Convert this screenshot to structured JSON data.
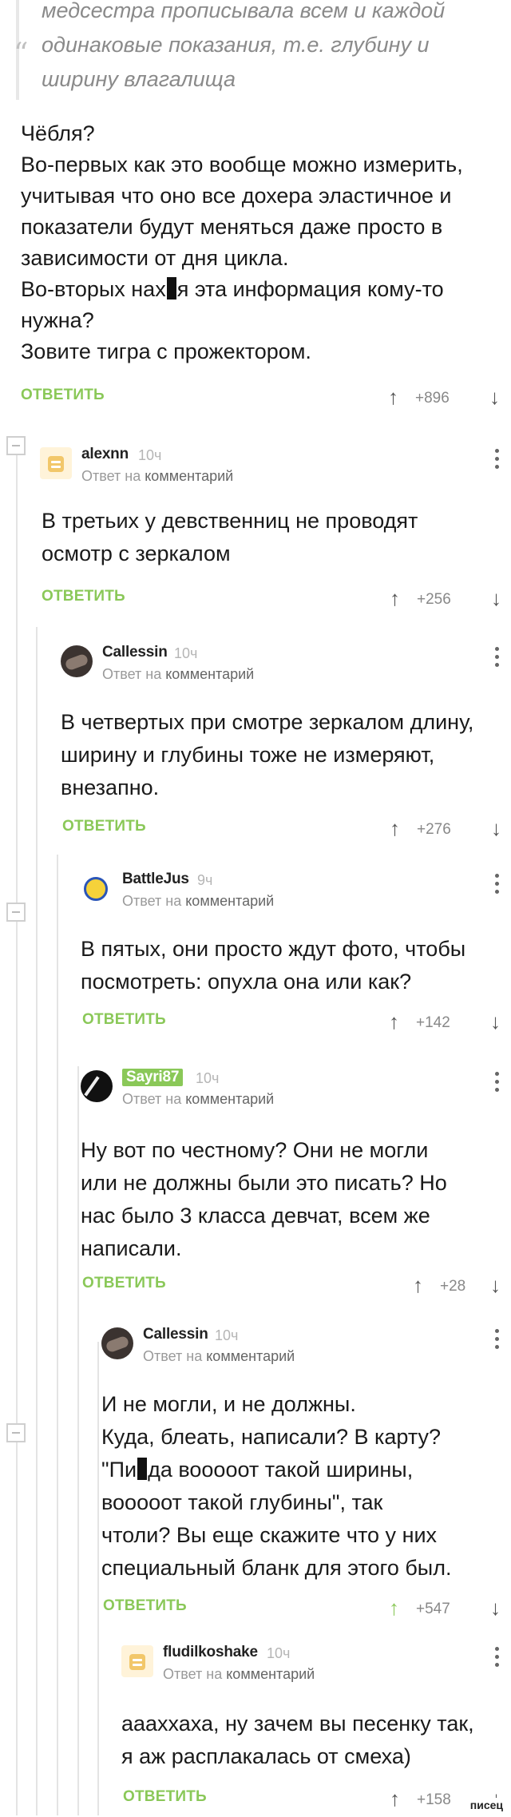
{
  "quote": {
    "lines": [
      "медсестра прописывала всем и каждой",
      "одинаковые показания, т.е. глубину и",
      "ширину влагалища"
    ]
  },
  "root": {
    "lines": [
      "Чёбля?",
      "Во-первых как это вообще можно измерить,",
      "учитывая что оно все дохера эластичное и",
      "показатели будут меняться даже просто в",
      "зависимости от дня цикла."
    ],
    "line6_a": "Во-вторых нах",
    "line6_b": "я эта информация кому-то",
    "line7": "нужна?",
    "line8": "Зовите тигра с прожектором.",
    "score": "+896"
  },
  "labels": {
    "reply": "ОТВЕТИТЬ",
    "reply_to": "Ответ на",
    "comment": "комментарий"
  },
  "comments": [
    {
      "user": "alexnn",
      "time": "10ч",
      "avatar": "egg-icon",
      "lines": [
        "В третьих у девственниц не проводят",
        "осмотр с зеркалом"
      ],
      "score": "+256"
    },
    {
      "user": "Callessin",
      "time": "10ч",
      "avatar": "photo-icon",
      "lines": [
        "В четвертых при смотре зеркалом длину,",
        "ширину и глубины тоже не измеряют,",
        "внезапно."
      ],
      "score": "+276"
    },
    {
      "user": "BattleJus",
      "time": "9ч",
      "avatar": "simpson-icon",
      "lines": [
        "В пятых, они просто ждут фото, чтобы",
        "посмотреть: опухла она или как?"
      ],
      "score": "+142"
    },
    {
      "user": "Sayri87",
      "time": "10ч",
      "avatar": "guitar-icon",
      "lines": [
        "Ну вот по честному? Они не могли",
        "или не должны были это писать? Но",
        "нас было 3 класса девчат, всем же",
        "написали."
      ],
      "score": "+28"
    },
    {
      "user": "Callessin",
      "time": "10ч",
      "avatar": "photo-icon",
      "lines": [
        "И не могли, и не должны.",
        "Куда, блеать, написали? В карту?"
      ],
      "line3_a": "\"Пи",
      "line3_b": "да вооооот такой ширины,",
      "lines_tail": [
        "вооооот такой глубины\", так",
        "чтоли? Вы еще скажите что у них",
        "специальный бланк для этого был."
      ],
      "score": "+547"
    },
    {
      "user": "fludilkoshake",
      "time": "10ч",
      "avatar": "egg-icon",
      "lines": [
        "аааххаха, ну зачем вы песенку так,",
        "я аж расплакалась от смеха)"
      ],
      "score": "+158"
    }
  ],
  "watermark": "писец",
  "colors": {
    "accent": "#8ac858",
    "text": "#1a1a1a",
    "muted": "#9a9a9a"
  }
}
